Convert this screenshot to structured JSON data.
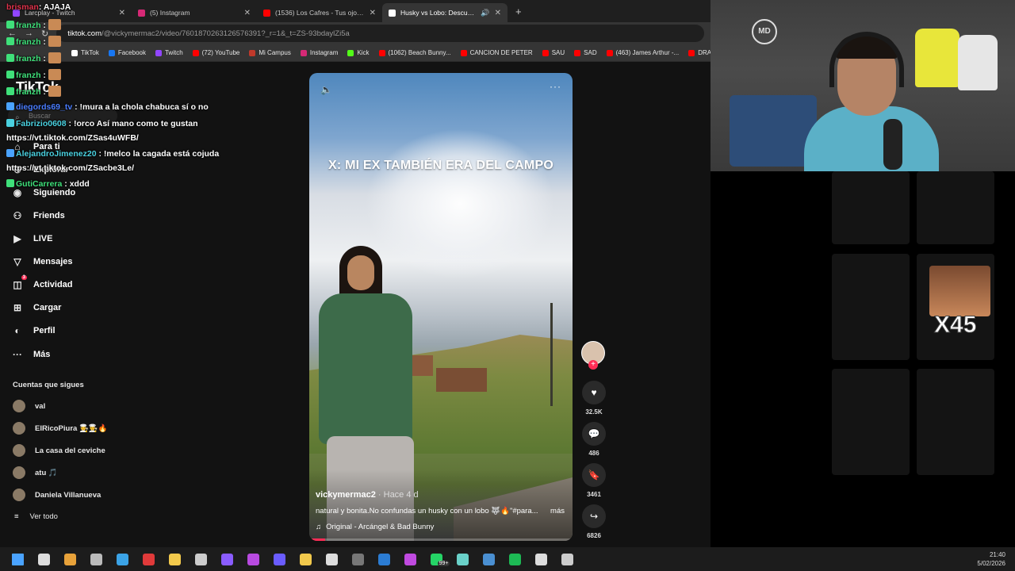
{
  "browser": {
    "tabs": [
      {
        "title": "Larcplay - Twitch",
        "color": "#9146ff",
        "active": false
      },
      {
        "title": "(5) Instagram",
        "color": "#d62976",
        "active": false
      },
      {
        "title": "(1536) Los Cafres - Tus ojos (Vi",
        "color": "#ff0000",
        "active": false
      },
      {
        "title": "Husky vs Lobo: Descubre la",
        "color": "#ffffff",
        "active": true
      }
    ],
    "new_tab": "+",
    "url_host": "tiktok.com",
    "url_path": "/@vickymermac2/video/7601870263126576391?_r=1&_t=ZS-93bdaylZi5a",
    "bookmarks": [
      {
        "label": "TikTok",
        "color": "#ffffff"
      },
      {
        "label": "Facebook",
        "color": "#1877f2"
      },
      {
        "label": "Twitch",
        "color": "#9146ff"
      },
      {
        "label": "(72) YouTube",
        "color": "#ff0000"
      },
      {
        "label": "Mi Campus",
        "color": "#c0392b"
      },
      {
        "label": "Instagram",
        "color": "#d62976"
      },
      {
        "label": "Kick",
        "color": "#53fc18"
      },
      {
        "label": "(1062) Beach Bunny...",
        "color": "#ff0000"
      },
      {
        "label": "CANCION DE PETER",
        "color": "#ff0000"
      },
      {
        "label": "SAU",
        "color": "#ff0000"
      },
      {
        "label": "SAD",
        "color": "#ff0000"
      },
      {
        "label": "(463) James Arthur -...",
        "color": "#ff0000"
      },
      {
        "label": "DRA",
        "color": "#ff0000"
      }
    ]
  },
  "tiktok": {
    "logo": "TikTok",
    "search_placeholder": "Buscar",
    "nav": [
      {
        "icon": "⌂",
        "label": "Para ti",
        "badge": ""
      },
      {
        "icon": "⊙",
        "label": "Explorar",
        "badge": ""
      },
      {
        "icon": "◉",
        "label": "Siguiendo",
        "badge": ""
      },
      {
        "icon": "⚇",
        "label": "Friends",
        "badge": ""
      },
      {
        "icon": "▶",
        "label": "LIVE",
        "badge": ""
      },
      {
        "icon": "▽",
        "label": "Mensajes",
        "badge": ""
      },
      {
        "icon": "◫",
        "label": "Actividad",
        "badge": "3"
      },
      {
        "icon": "⊞",
        "label": "Cargar",
        "badge": ""
      },
      {
        "icon": "◐",
        "label": "Perfil",
        "badge": ""
      },
      {
        "icon": "···",
        "label": "Más",
        "badge": ""
      }
    ],
    "following_title": "Cuentas que sigues",
    "following": [
      "val",
      "ElRicoPiura 🧑‍🍳👨‍🍳🔥",
      "La casa del ceviche",
      "atu 🎵",
      "Daniela Villanueva"
    ],
    "see_all": "Ver todo",
    "video": {
      "overlay_text": "X: MI EX TAMBIÉN ERA DEL CAMPO",
      "username": "vickymermac2",
      "posted": " · Hace 4 d",
      "description": "natural y bonita.No confundas un husky con un lobo 🐺🔥\"#para...",
      "more": "más",
      "music": "Original - Arcángel & Bad Bunny",
      "progress": 0.06
    },
    "actions": {
      "likes": "32.5K",
      "comments": "486",
      "saves": "3461",
      "shares": "6826"
    }
  },
  "chat": [
    {
      "user": "brisman",
      "color": "#e0334b",
      "text": ": AJAJA",
      "badge": "",
      "emote": false
    },
    {
      "user": "franzh",
      "color": "#3fe07a",
      "text": " :",
      "badge": "#3fe07a",
      "emote": true
    },
    {
      "user": "franzh",
      "color": "#3fe07a",
      "text": " :",
      "badge": "#3fe07a",
      "emote": true
    },
    {
      "user": "franzh",
      "color": "#3fe07a",
      "text": " :",
      "badge": "#3fe07a",
      "emote": true
    },
    {
      "user": "franzh",
      "color": "#3fe07a",
      "text": " :",
      "badge": "#3fe07a",
      "emote": true
    },
    {
      "user": "franzh",
      "color": "#3fe07a",
      "text": " :",
      "badge": "#3fe07a",
      "emote": true
    },
    {
      "user": "diegords69_tv",
      "color": "#4a7dff",
      "text": " : !mura a la chola chabuca sí o no",
      "badge": "#4aa3ff",
      "emote": false
    },
    {
      "user": "Fabrizio0608",
      "color": "#4ad1e0",
      "text": " : !orco Así mano como te gustan",
      "badge": "#4ad1e0",
      "emote": false
    },
    {
      "user": "",
      "color": "#ffffff",
      "text": "https://vt.tiktok.com/ZSas4uWFB/",
      "badge": "",
      "emote": false
    },
    {
      "user": "AlejandroJimenez20",
      "color": "#4ad1e0",
      "text": " : !melco la cagada está cojuda",
      "badge": "#4aa3ff",
      "emote": false
    },
    {
      "user": "",
      "color": "#ffffff",
      "text": "https://vt.tiktok.com/ZSacbe3Le/",
      "badge": "",
      "emote": false
    },
    {
      "user": "GutiCarrera",
      "color": "#3fe07a",
      "text": " : xddd",
      "badge": "#3fe07a",
      "emote": false
    }
  ],
  "webcam": {
    "logo_text": "MD"
  },
  "overlay_emote": {
    "text": "X45"
  },
  "taskbar": {
    "icons": [
      "windows-start",
      "search",
      "store",
      "cat",
      "edge",
      "app-red",
      "folder",
      "chevron",
      "discord-like",
      "purple-app",
      "messenger",
      "chrome",
      "obs",
      "calculator",
      "word",
      "purple-app-2",
      "whatsapp",
      "app-teal",
      "steam",
      "spotify",
      "app-clock",
      "app-shield"
    ],
    "whatsapp_badge": "99+",
    "time": "21:40",
    "date": "5/02/2026"
  }
}
